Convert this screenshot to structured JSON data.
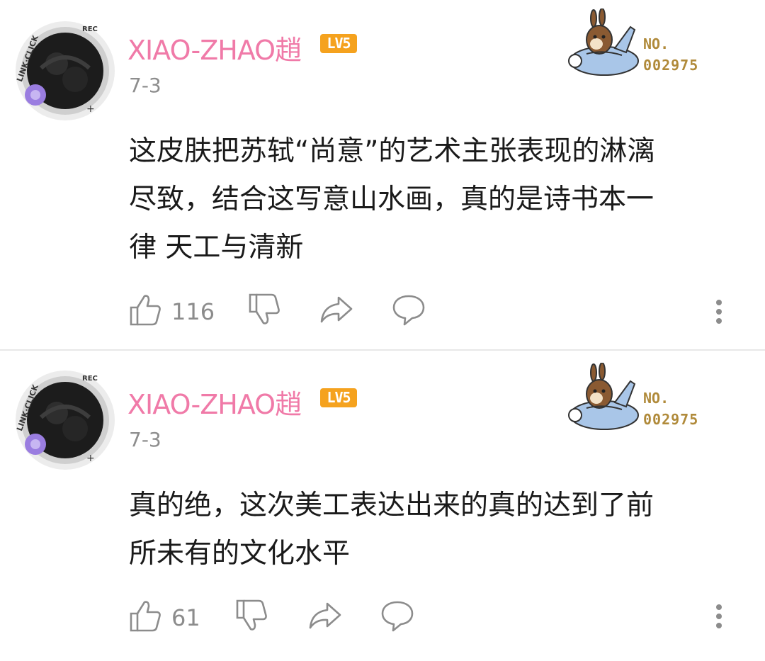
{
  "comments": [
    {
      "username": "XIAO-ZHAO趙",
      "level": "LV5",
      "date": "7-3",
      "avatar_ring_text": "LINK·CLICK",
      "avatar_rec_text": "REC",
      "badge": {
        "label": "NO.",
        "number": "002975"
      },
      "text": "这皮肤把苏轼“尚意”的艺术主张表现的淋漓\n尽致，结合这写意山水画，真的是诗书本一\n律 天工与清新",
      "likes": "116"
    },
    {
      "username": "XIAO-ZHAO趙",
      "level": "LV5",
      "date": "7-3",
      "avatar_ring_text": "LINK·CLICK",
      "avatar_rec_text": "REC",
      "badge": {
        "label": "NO.",
        "number": "002975"
      },
      "text": "真的绝，这次美工表达出来的真的达到了前\n所未有的文化水平",
      "likes": "61"
    }
  ],
  "colors": {
    "username": "#f07aa8",
    "level_badge": "#f5a21e",
    "badge_number": "#b08a3a",
    "icons": "#8c8c8c"
  },
  "icons": [
    "thumbs-up-icon",
    "thumbs-down-icon",
    "share-icon",
    "comment-icon",
    "more-vertical-icon"
  ]
}
